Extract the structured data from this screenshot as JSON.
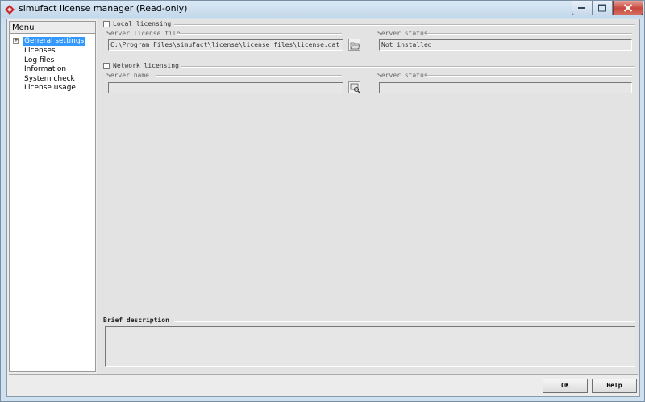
{
  "window": {
    "title": "simufact license manager (Read-only)",
    "icon": "simufact-app-icon"
  },
  "menu": {
    "header": "Menu",
    "items": [
      {
        "label": "General settings",
        "selected": true
      },
      {
        "label": "Licenses"
      },
      {
        "label": "Log files"
      },
      {
        "label": "Information"
      },
      {
        "label": "System check"
      },
      {
        "label": "License usage"
      }
    ]
  },
  "local": {
    "checkbox_label": "Local licensing",
    "checked": false,
    "file_label": "Server license file",
    "file_value": "C:\\Program Files\\simufact\\license\\license_files\\license.dat",
    "status_label": "Server status",
    "status_value": "Not installed",
    "browse_icon": "folder-open-icon"
  },
  "network": {
    "checkbox_label": "Network licensing",
    "checked": false,
    "server_label": "Server name",
    "server_value": "",
    "status_label": "Server status",
    "status_value": "",
    "search_icon": "search-server-icon"
  },
  "description": {
    "label": "Brief description",
    "value": ""
  },
  "buttons": {
    "ok": "OK",
    "help": "Help"
  },
  "colors": {
    "selection": "#3399ff",
    "close_button": "#c7473b"
  }
}
